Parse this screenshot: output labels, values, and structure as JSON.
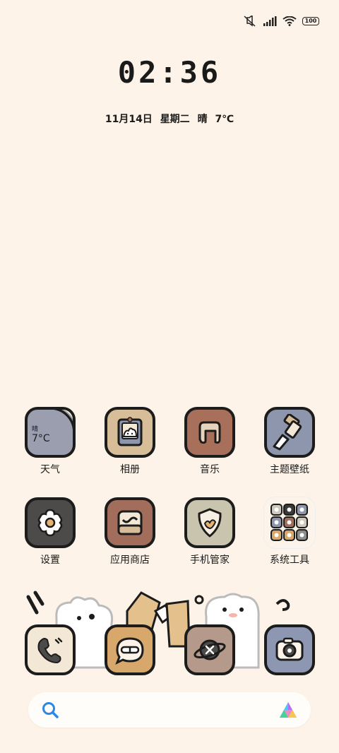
{
  "status": {
    "battery": "100",
    "icons": [
      "mute-icon",
      "signal-icon",
      "wifi-icon",
      "battery-icon"
    ]
  },
  "clock": {
    "time": "02:36",
    "date": "11月14日",
    "weekday": "星期二",
    "weather": "晴",
    "temperature": "7℃"
  },
  "apps_row1": [
    {
      "label": "天气",
      "icon": "weather-icon",
      "weather_text": "晴",
      "weather_temp": "7°C"
    },
    {
      "label": "相册",
      "icon": "gallery-icon"
    },
    {
      "label": "音乐",
      "icon": "music-icon"
    },
    {
      "label": "主题壁纸",
      "icon": "theme-brush-icon"
    }
  ],
  "apps_row2": [
    {
      "label": "设置",
      "icon": "settings-flower-icon"
    },
    {
      "label": "应用商店",
      "icon": "app-store-icon"
    },
    {
      "label": "手机管家",
      "icon": "security-shield-icon"
    },
    {
      "label": "系统工具",
      "icon": "system-tools-folder-icon"
    }
  ],
  "dock": [
    {
      "name": "phone",
      "icon": "phone-icon"
    },
    {
      "name": "messages",
      "icon": "message-icon"
    },
    {
      "name": "browser",
      "icon": "planet-browser-icon"
    },
    {
      "name": "camera",
      "icon": "camera-icon"
    }
  ],
  "search": {
    "icon": "search-icon",
    "assistant_icon": "assistant-logo-icon"
  },
  "colors": {
    "background": "#fdf3e8",
    "weather_tile": "#9a9eae",
    "gallery_tile": "#d7bd98",
    "music_tile": "#a8705a",
    "theme_tile": "#8e96ad",
    "settings_tile": "#4d4a4a",
    "store_tile": "#a26d5b",
    "security_tile": "#c9c4ad",
    "phone_tile": "#f3e7d6",
    "message_tile": "#d8a76c",
    "browser_tile": "#b59a8c",
    "camera_tile": "#8d97b2"
  }
}
